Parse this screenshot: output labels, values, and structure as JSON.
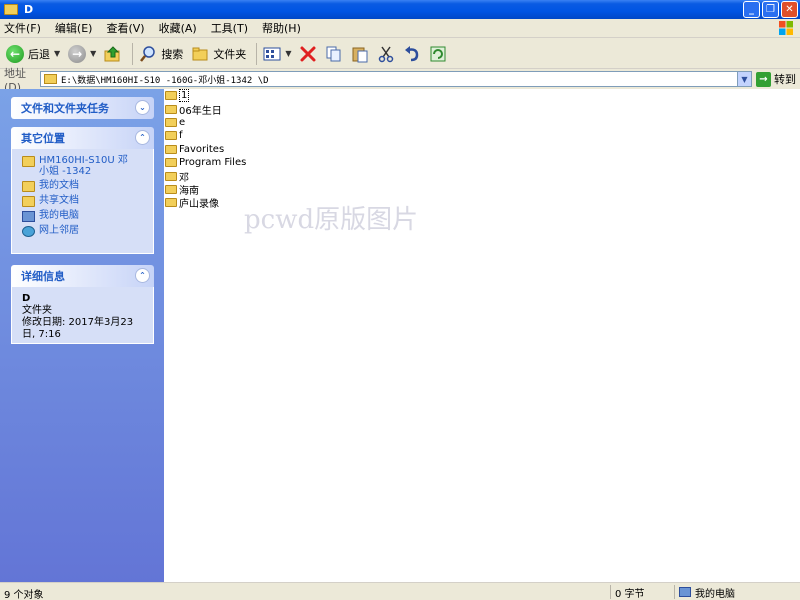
{
  "window": {
    "title": "D"
  },
  "menu": {
    "items": [
      "文件(F)",
      "编辑(E)",
      "查看(V)",
      "收藏(A)",
      "工具(T)",
      "帮助(H)"
    ]
  },
  "toolbar": {
    "back": "后退",
    "search": "搜索",
    "folders": "文件夹"
  },
  "address": {
    "label": "地址(D)",
    "path": "E:\\数据\\HM160HI-S10                 -160G-邓小姐-1342                    \\D",
    "go": "转到"
  },
  "tasks": {
    "file_tasks": {
      "title": "文件和文件夹任务"
    },
    "other_places": {
      "title": "其它位置",
      "items": [
        "HM160HI-S10U 邓小姐 -1342",
        "我的文档",
        "共享文档",
        "我的电脑",
        "网上邻居"
      ]
    },
    "details": {
      "title": "详细信息",
      "name": "D",
      "type": "文件夹",
      "modified": "修改日期: 2017年3月23日, 7:16"
    }
  },
  "files": [
    "1",
    "06年生日",
    "e",
    "f",
    "Favorites",
    "Program Files",
    "邓",
    "海南",
    "庐山录像"
  ],
  "watermark": "pcwd原版图片",
  "status": {
    "objects": "9 个对象",
    "size": "0 字节",
    "location": "我的电脑"
  }
}
